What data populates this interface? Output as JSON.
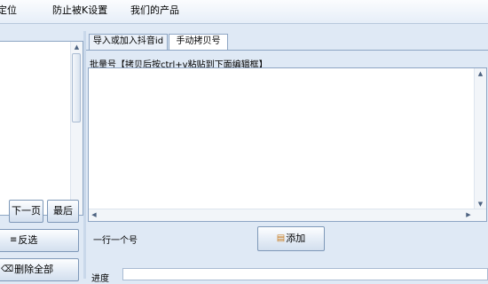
{
  "menu": {
    "items": [
      {
        "label": "定位"
      },
      {
        "label": "防止被K设置"
      },
      {
        "label": "我们的产品"
      }
    ]
  },
  "left_panel": {
    "next_page": "下一页",
    "last_page": "最后",
    "invert_select": "反选",
    "delete_all": "删除全部"
  },
  "tabs": [
    {
      "label": "导入或加入抖音id",
      "active": false
    },
    {
      "label": "手动拷贝号",
      "active": true
    }
  ],
  "manual_copy": {
    "batch_label": "批量号【拷贝后按ctrl+v粘贴到下面编辑框】",
    "textarea_value": "",
    "hint": "一行一个号",
    "add_button": "添加"
  },
  "status": {
    "progress_label": "进度"
  },
  "icons": {
    "invert": "list-lines-icon",
    "delete": "eraser-icon",
    "add": "folder-add-icon"
  }
}
